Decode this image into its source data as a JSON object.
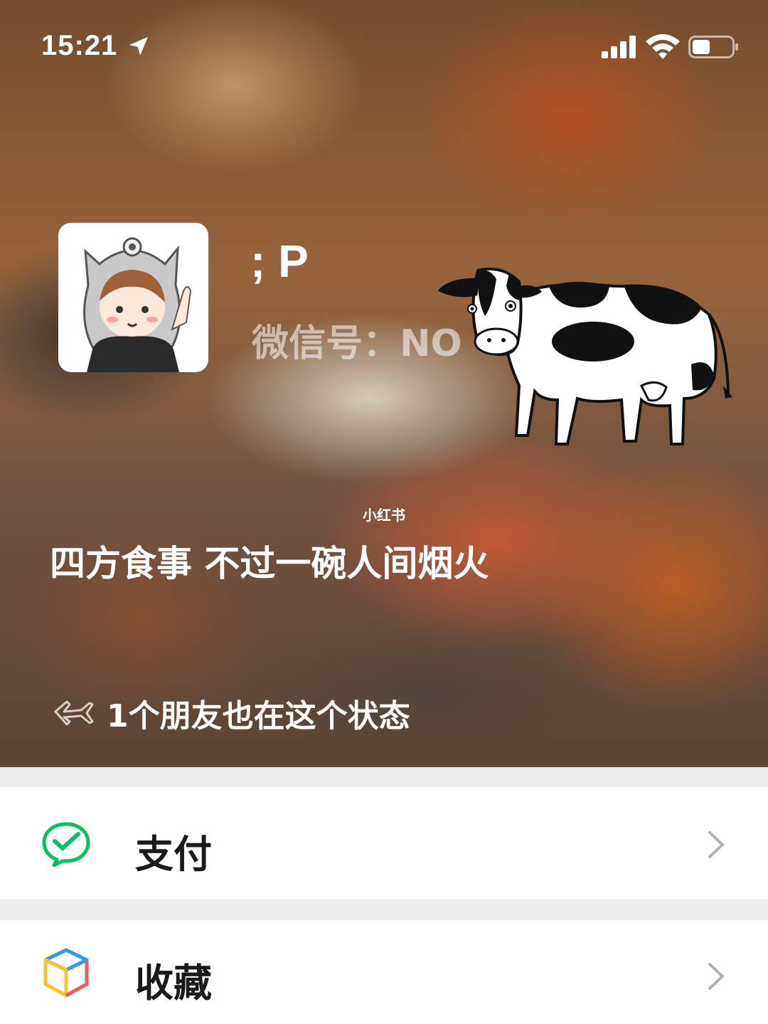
{
  "status_bar": {
    "time": "15:21"
  },
  "profile": {
    "nickname": "; P",
    "wechat_id_label": "微信号：",
    "wechat_id_value": "NO"
  },
  "watermark": "小红书",
  "status": {
    "text": "四方食事 不过一碗人间烟火",
    "friends_text": "1个朋友也在这个状态"
  },
  "menu": {
    "pay_label": "支付",
    "favorites_label": "收藏"
  },
  "colors": {
    "pay_green": "#07c160",
    "background_gray": "#ededed",
    "chevron_gray": "#b2b2b2"
  }
}
